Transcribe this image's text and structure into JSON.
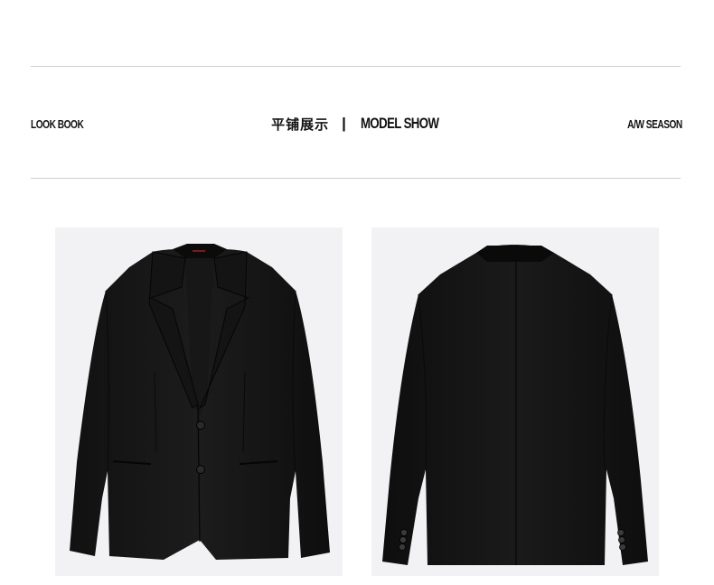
{
  "header": {
    "left_label": "LOOK BOOK",
    "title_cn": "平铺展示",
    "separator": "|",
    "title_en": "MODEL SHOW",
    "right_label": "A/W SEASON"
  },
  "gallery": {
    "images": [
      {
        "name": "blazer-front-image",
        "alt": "Black blazer front view"
      },
      {
        "name": "blazer-back-image",
        "alt": "Black blazer back view"
      }
    ]
  }
}
